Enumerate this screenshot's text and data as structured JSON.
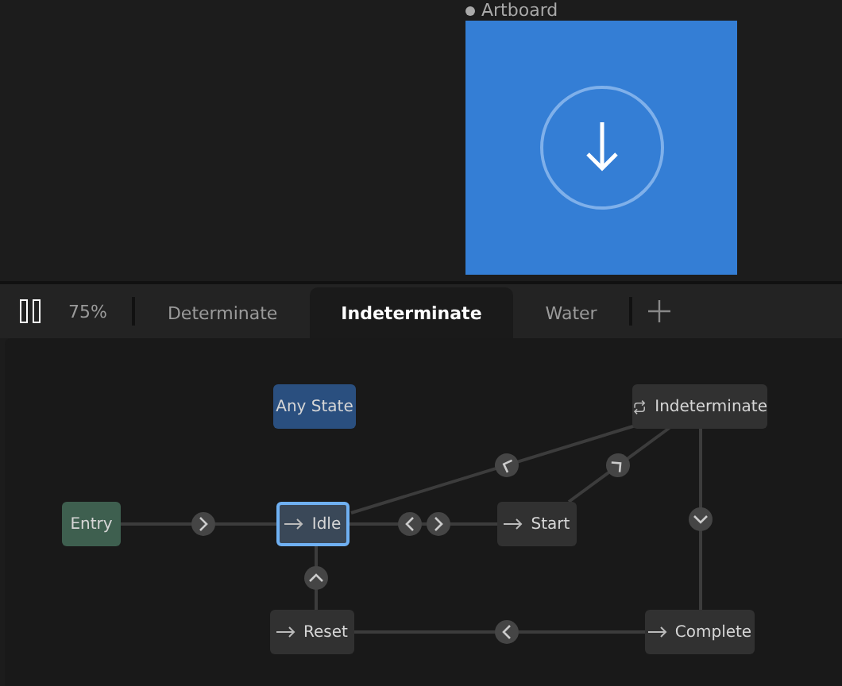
{
  "artboard": {
    "label": "Artboard"
  },
  "toolbar": {
    "zoom": "75%"
  },
  "tabs": [
    {
      "label": "Determinate",
      "selected": false
    },
    {
      "label": "Indeterminate",
      "selected": true
    },
    {
      "label": "Water",
      "selected": false
    }
  ],
  "nodes": [
    {
      "label": "Any State",
      "kind": "any",
      "selected": false
    },
    {
      "label": "Indeterminate",
      "kind": "loop",
      "selected": false
    },
    {
      "label": "Entry",
      "kind": "entry",
      "selected": false
    },
    {
      "label": "Idle",
      "kind": "state",
      "selected": true
    },
    {
      "label": "Start",
      "kind": "state",
      "selected": false
    },
    {
      "label": "Reset",
      "kind": "state",
      "selected": false
    },
    {
      "label": "Complete",
      "kind": "state",
      "selected": false
    }
  ]
}
